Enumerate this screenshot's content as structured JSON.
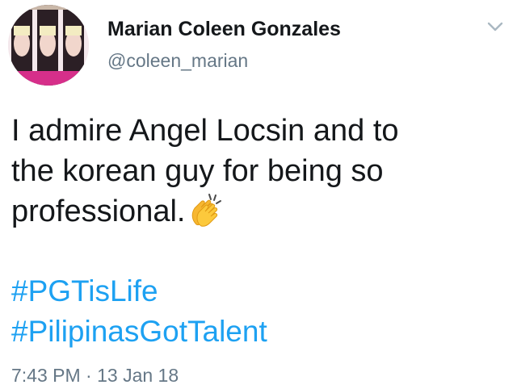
{
  "user": {
    "display_name": "Marian Coleen Gonzales",
    "handle": "@coleen_marian"
  },
  "tweet": {
    "lines": [
      "I admire Angel Locsin and to",
      "the korean guy for being so",
      "professional."
    ],
    "emoji": "clapping-hands",
    "hashtags": [
      "#PGTisLife",
      "#PilipinasGotTalent"
    ],
    "time": "7:43 PM",
    "separator": "·",
    "date": "13 Jan 18"
  },
  "colors": {
    "link": "#1da1f2",
    "secondary_text": "#657786",
    "primary_text": "#14171a"
  }
}
